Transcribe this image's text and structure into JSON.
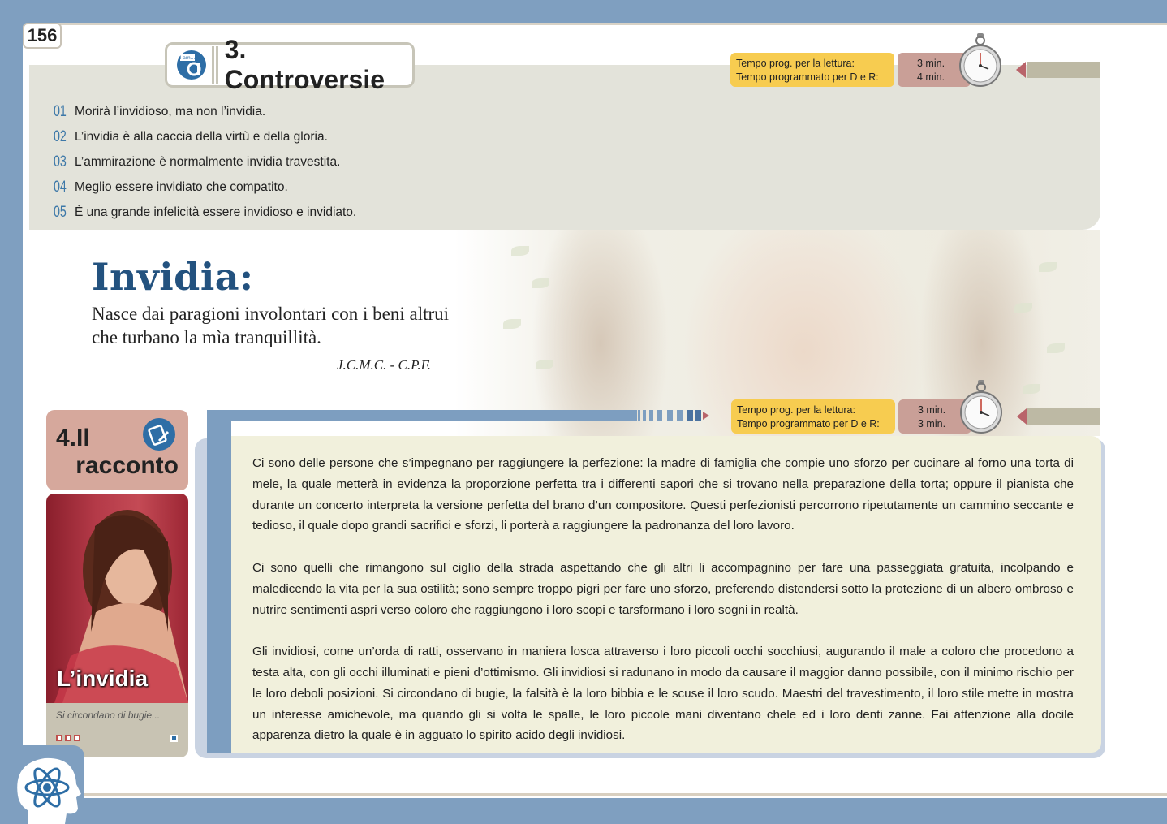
{
  "page_number": "156",
  "section3": {
    "title": "3. Controversie",
    "icon_label": "I am...",
    "quotes": [
      {
        "num": "01",
        "text": "Morirà l’invidioso, ma non l’invidia."
      },
      {
        "num": "02",
        "text": "L’invidia è alla caccia della virtù e della gloria."
      },
      {
        "num": "03",
        "text": "L’ammirazione è normalmente invidia travestita."
      },
      {
        "num": "04",
        "text": "Meglio essere invidiato che compatito."
      },
      {
        "num": "05",
        "text": "È una grande infelicità essere invidioso e invidiato."
      }
    ]
  },
  "timer1": {
    "line1_label": "Tempo prog. per la lettura:",
    "line2_label": "Tempo programmato per D e R:",
    "line1_value": "3 min.",
    "line2_value": "4 min."
  },
  "timer2": {
    "line1_label": "Tempo prog. per la lettura:",
    "line2_label": "Tempo programmato per D e R:",
    "line1_value": "3 min.",
    "line2_value": "3 min."
  },
  "hero": {
    "title": "Invidia:",
    "line1": "Nasce dai paragioni involontari con i beni altrui",
    "line2": "che turbano la mìa tranquillità.",
    "author": "J.C.M.C. - C.P.F."
  },
  "section4": {
    "num": "4.Il",
    "word": "racconto",
    "card_title": "L’invidia",
    "card_caption": "Si circondano di bugie..."
  },
  "story": {
    "p1": "Ci sono delle persone che s’impegnano per raggiungere la perfezione: la madre di famiglia che compie uno sforzo per cucinare al forno una torta di mele, la quale metterà in evidenza la proporzione perfetta tra i differenti sapori che si trovano nella preparazione della torta; oppure il pianista che durante un concerto interpreta la versione perfetta del brano d’un compositore. Questi perfezionisti percorrono ripetutamente un cammino seccante e tedioso, il quale dopo grandi sacrifici e sforzi, li porterà a raggiungere la padronanza del loro lavoro.",
    "p2": "Ci sono quelli che rimangono sul ciglio della strada aspettando che gli altri li accompagnino per fare una passeggiata gratuita, incolpando e maledicendo la vita per la sua ostilità; sono sempre troppo pigri per fare uno sforzo, preferendo distendersi sotto la protezione di un albero ombroso e nutrire sentimenti aspri verso coloro che raggiungono i loro scopi e tarsformano i loro sogni in realtà.",
    "p3": "Gli invidiosi, come un’orda di ratti, osservano in maniera losca attraverso i loro piccoli occhi socchiusi, augurando il male a coloro che procedono a testa alta, con gli occhi illuminati e pieni d’ottimismo. Gli invidiosi si radunano in modo da causare il maggior danno possibile, con il minimo rischio per le loro deboli posizioni. Si circondano di bugie, la falsità è la loro bibbia e le scuse il loro scudo. Maestri del travestimento, il loro stile mette in mostra un interesse amichevole, ma quando gli si volta le spalle, le loro piccole mani diventano chele ed i loro denti zanne. Fai attenzione alla docile apparenza dietro la quale è in agguato lo spirito acido degli invidiosi."
  },
  "colors": {
    "frame_blue": "#7f9fc0",
    "title_blue": "#23527f",
    "timer_yellow": "#f7cc50",
    "timer_pink": "#c99f97",
    "racconto_tab": "#d6a89c",
    "text_panel": "#f1f0dc"
  },
  "icons": [
    "i-am-logo-icon",
    "stopwatch-icon",
    "book-pen-icon",
    "atom-head-icon"
  ]
}
